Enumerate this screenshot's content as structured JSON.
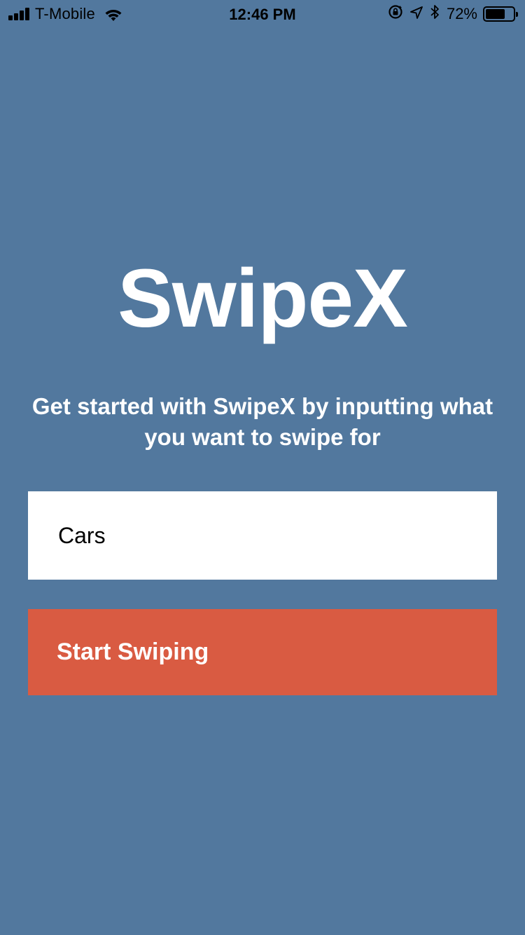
{
  "status_bar": {
    "carrier": "T-Mobile",
    "time": "12:46 PM",
    "battery_percent": "72%",
    "battery_level": 0.72,
    "icons": [
      "signal-icon",
      "wifi-icon",
      "rotation-lock-icon",
      "location-icon",
      "bluetooth-icon",
      "battery-icon"
    ]
  },
  "app": {
    "title": "SwipeX",
    "subtitle": "Get started with SwipeX by inputting what you want to swipe for"
  },
  "search": {
    "value": "Cars",
    "placeholder": ""
  },
  "actions": {
    "start_label": "Start Swiping"
  },
  "colors": {
    "background": "#52789e",
    "button": "#d95b42",
    "input": "#ffffff",
    "text": "#ffffff"
  }
}
